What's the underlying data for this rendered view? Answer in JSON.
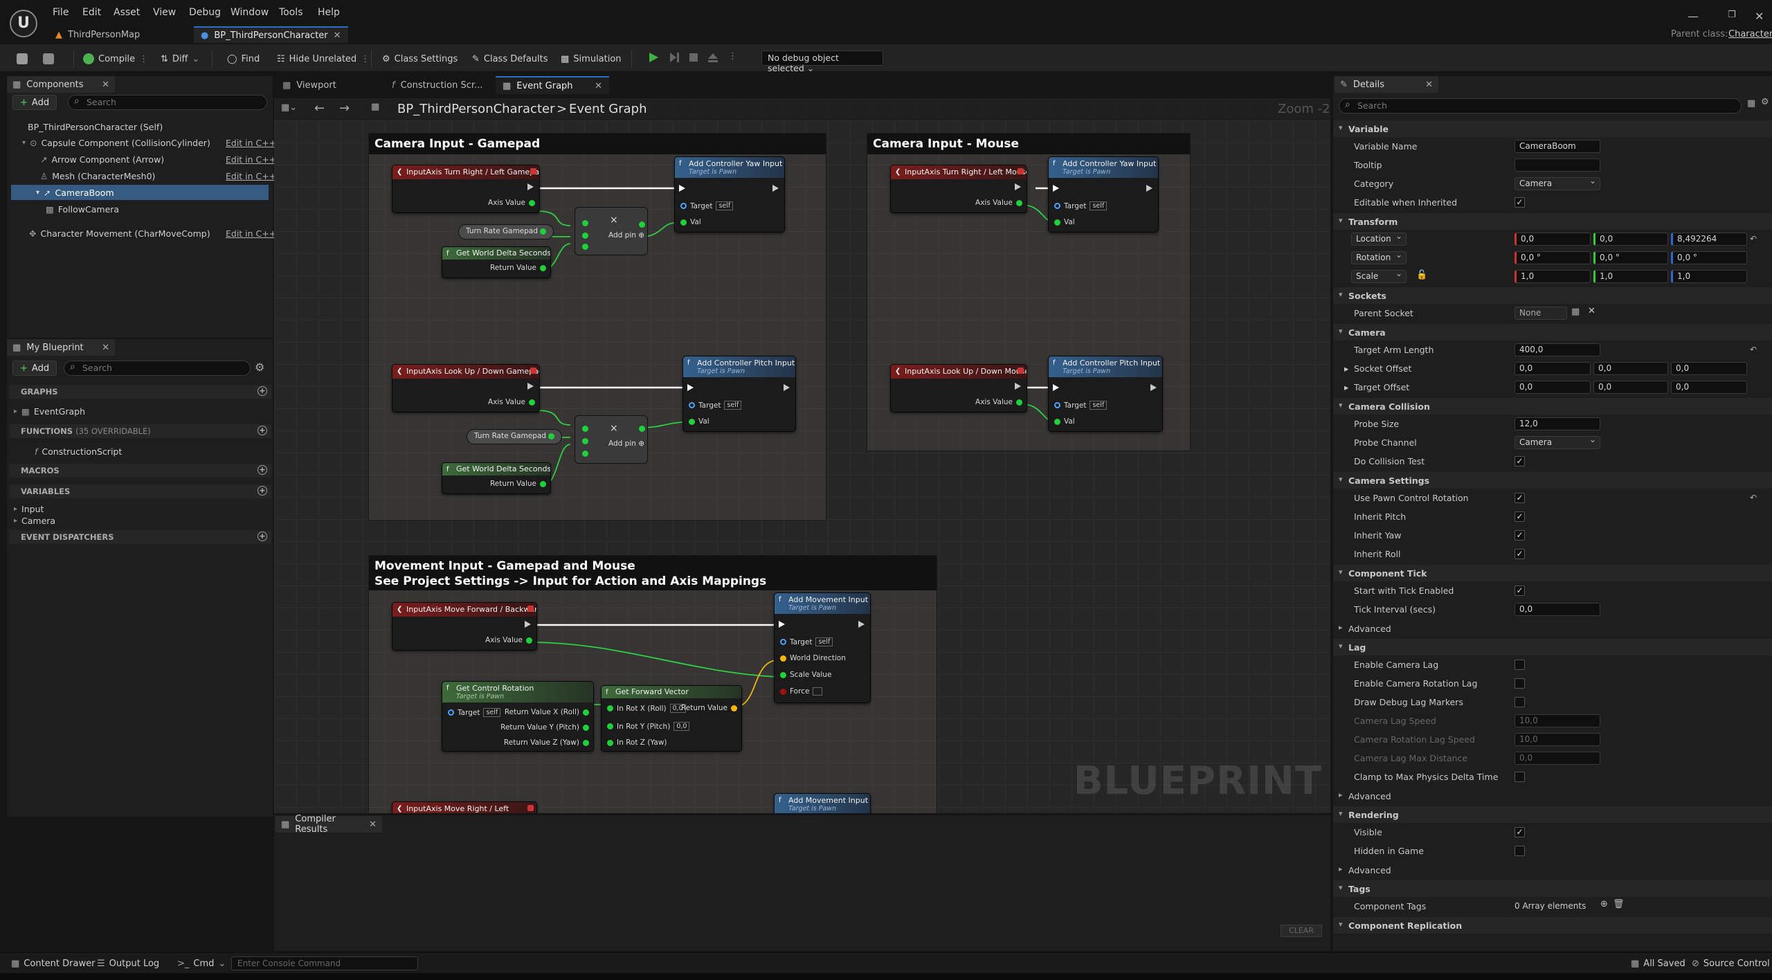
{
  "app": {
    "menu": [
      "File",
      "Edit",
      "Asset",
      "View",
      "Debug",
      "Window",
      "Tools",
      "Help"
    ],
    "doc_tabs": [
      "ThirdPersonMap",
      "BP_ThirdPersonCharacter"
    ],
    "parent_class_label": "Parent class:",
    "parent_class_value": "Character"
  },
  "toolbar": {
    "compile": "Compile",
    "diff": "Diff",
    "find": "Find",
    "hide_unrelated": "Hide Unrelated",
    "class_settings": "Class Settings",
    "class_defaults": "Class Defaults",
    "simulation": "Simulation",
    "debug_object": "No debug object selected"
  },
  "components": {
    "tab": "Components",
    "add": "Add",
    "search_placeholder": "Search",
    "root": "BP_ThirdPersonCharacter (Self)",
    "items": [
      {
        "label": "Capsule Component (CollisionCylinder)",
        "edit": "Edit in C++"
      },
      {
        "label": "Arrow Component (Arrow)",
        "edit": "Edit in C++"
      },
      {
        "label": "Mesh (CharacterMesh0)",
        "edit": "Edit in C++"
      },
      {
        "label": "CameraBoom",
        "edit": ""
      },
      {
        "label": "FollowCamera",
        "edit": ""
      },
      {
        "label": "Character Movement (CharMoveComp)",
        "edit": "Edit in C++"
      }
    ]
  },
  "my_blueprint": {
    "tab": "My Blueprint",
    "add": "Add",
    "search_placeholder": "Search",
    "graphs_h": "GRAPHS",
    "graphs": [
      "EventGraph"
    ],
    "functions_h": "FUNCTIONS",
    "functions_note": "(35 OVERRIDABLE)",
    "functions": [
      "ConstructionScript"
    ],
    "macros_h": "MACROS",
    "variables_h": "VARIABLES",
    "variables": [
      "Input",
      "Camera"
    ],
    "dispatchers_h": "EVENT DISPATCHERS"
  },
  "graph": {
    "tabs": [
      "Viewport",
      "Construction Scr...",
      "Event Graph"
    ],
    "breadcrumb_root": "BP_ThirdPersonCharacter",
    "breadcrumb_sep": ">",
    "breadcrumb_leaf": "Event Graph",
    "zoom": "Zoom -2",
    "watermark": "BLUEPRINT",
    "comments": {
      "c1": "Camera Input - Gamepad",
      "c2": "Camera Input - Mouse",
      "c3_line1": "Movement Input - Gamepad and Mouse",
      "c3_line2": "See Project Settings -> Input for Action and Axis Mappings"
    },
    "nodes": {
      "turn_gamepad": "InputAxis Turn Right / Left Gamepad",
      "lookup_gamepad": "InputAxis Look Up / Down Gamepad",
      "turn_mouse": "InputAxis Turn Right / Left Mouse",
      "lookup_mouse": "InputAxis Look Up / Down Mouse",
      "move_fwd": "InputAxis Move Forward / Backward",
      "move_right": "InputAxis Move Right / Left",
      "axis_value": "Axis Value",
      "yaw_input": "Add Controller Yaw Input",
      "pitch_input": "Add Controller Pitch Input",
      "target_is_pawn": "Target is Pawn",
      "target": "Target",
      "self": "self",
      "val": "Val",
      "turn_rate": "Turn Rate Gamepad",
      "delta_seconds": "Get World Delta Seconds",
      "return_value": "Return Value",
      "add_pin": "Add pin",
      "add_movement": "Add Movement Input",
      "world_direction": "World Direction",
      "scale_value": "Scale Value",
      "force": "Force",
      "get_control_rotation": "Get Control Rotation",
      "ret_x": "Return Value X (Roll)",
      "ret_y": "Return Value Y (Pitch)",
      "ret_z": "Return Value Z (Yaw)",
      "get_forward_vector": "Get Forward Vector",
      "in_rot_x": "In Rot X (Roll)",
      "in_rot_y": "In Rot Y (Pitch)",
      "in_rot_z": "In Rot Z (Yaw)",
      "zero": "0,0"
    }
  },
  "compiler": {
    "tab": "Compiler Results",
    "clear": "CLEAR"
  },
  "details": {
    "tab": "Details",
    "search_placeholder": "Search",
    "sec_variable": "Variable",
    "variable_name_l": "Variable Name",
    "variable_name_v": "CameraBoom",
    "tooltip_l": "Tooltip",
    "tooltip_v": "",
    "category_l": "Category",
    "category_v": "Camera",
    "editable_l": "Editable when Inherited",
    "sec_transform": "Transform",
    "location_l": "Location",
    "location_v": [
      "0,0",
      "0,0",
      "8,492264"
    ],
    "rotation_l": "Rotation",
    "rotation_v": [
      "0,0 °",
      "0,0 °",
      "0,0 °"
    ],
    "scale_l": "Scale",
    "scale_v": [
      "1,0",
      "1,0",
      "1,0"
    ],
    "sec_sockets": "Sockets",
    "parent_socket_l": "Parent Socket",
    "parent_socket_v": "None",
    "sec_camera": "Camera",
    "target_arm_l": "Target Arm Length",
    "target_arm_v": "400,0",
    "socket_offset_l": "Socket Offset",
    "socket_offset_v": [
      "0,0",
      "0,0",
      "0,0"
    ],
    "target_offset_l": "Target Offset",
    "target_offset_v": [
      "0,0",
      "0,0",
      "0,0"
    ],
    "sec_collision": "Camera Collision",
    "probe_size_l": "Probe Size",
    "probe_size_v": "12,0",
    "probe_channel_l": "Probe Channel",
    "probe_channel_v": "Camera",
    "do_collision_l": "Do Collision Test",
    "sec_cam_settings": "Camera Settings",
    "use_pawn_l": "Use Pawn Control Rotation",
    "inherit_pitch_l": "Inherit Pitch",
    "inherit_yaw_l": "Inherit Yaw",
    "inherit_roll_l": "Inherit Roll",
    "sec_tick": "Component Tick",
    "start_tick_l": "Start with Tick Enabled",
    "tick_interval_l": "Tick Interval (secs)",
    "tick_interval_v": "0,0",
    "advanced": "Advanced",
    "sec_lag": "Lag",
    "enable_lag_l": "Enable Camera Lag",
    "enable_rot_lag_l": "Enable Camera Rotation Lag",
    "draw_debug_l": "Draw Debug Lag Markers",
    "lag_speed_l": "Camera Lag Speed",
    "lag_speed_v": "10,0",
    "rot_lag_speed_l": "Camera Rotation Lag Speed",
    "rot_lag_speed_v": "10,0",
    "lag_max_l": "Camera Lag Max Distance",
    "lag_max_v": "0,0",
    "clamp_l": "Clamp to Max Physics Delta Time",
    "sec_rendering": "Rendering",
    "visible_l": "Visible",
    "hidden_l": "Hidden in Game",
    "sec_tags": "Tags",
    "component_tags_l": "Component Tags",
    "component_tags_v": "0 Array elements",
    "sec_replication": "Component Replication"
  },
  "status": {
    "content_drawer": "Content Drawer",
    "output_log": "Output Log",
    "cmd": "Cmd",
    "console_placeholder": "Enter Console Command",
    "all_saved": "All Saved",
    "source_control": "Source Control"
  },
  "colors": {
    "accent": "#2b6cc4",
    "selection": "#355b83",
    "event_node": "#7a1d1d",
    "function_node": "#35618e",
    "pure_node": "#3d6b3a",
    "float_pin": "#1fd13a",
    "vector_pin": "#f5b50a"
  }
}
